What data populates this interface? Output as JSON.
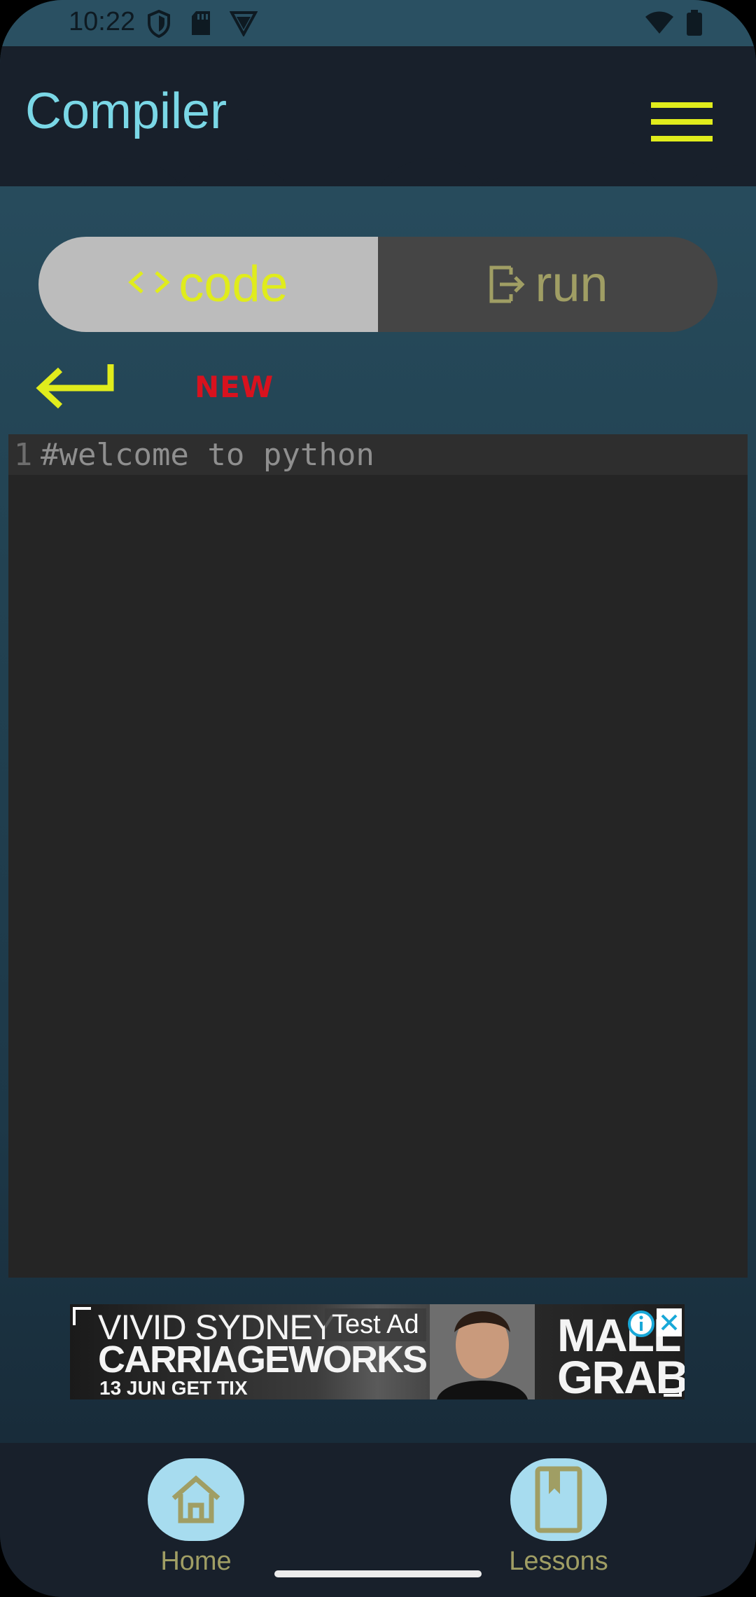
{
  "status_bar": {
    "time": "10:22",
    "icons": [
      "shield-icon",
      "sd-card-icon",
      "vpn-icon",
      "wifi-icon",
      "battery-icon"
    ]
  },
  "header": {
    "title": "Compiler",
    "menu_icon": "hamburger-menu-icon"
  },
  "toggle": {
    "code_label": "code",
    "run_label": "run",
    "active_tab": "code",
    "code_icon": "code-brackets-icon",
    "run_icon": "exit-arrow-icon"
  },
  "toolbar": {
    "back_icon": "return-arrow-icon",
    "new_label": "NEW"
  },
  "editor": {
    "lines": [
      {
        "number": "1",
        "text": "#welcome to python"
      }
    ]
  },
  "ad": {
    "label": "Test Ad",
    "headline_1": "VIVID SYDNEY",
    "headline_2": "CARRIAGEWORKS",
    "headline_3": "13 JUN GET TIX",
    "right_1": "MALL",
    "right_2": "GRAB"
  },
  "bottom_nav": {
    "items": [
      {
        "label": "Home",
        "icon": "home-icon"
      },
      {
        "label": "Lessons",
        "icon": "book-bookmark-icon"
      }
    ]
  },
  "colors": {
    "accent_yellow": "#e0ec1c",
    "title_cyan": "#7ad7e6",
    "new_red": "#d8121e",
    "nav_circle": "#a7dcef",
    "nav_label": "#a09e64"
  }
}
